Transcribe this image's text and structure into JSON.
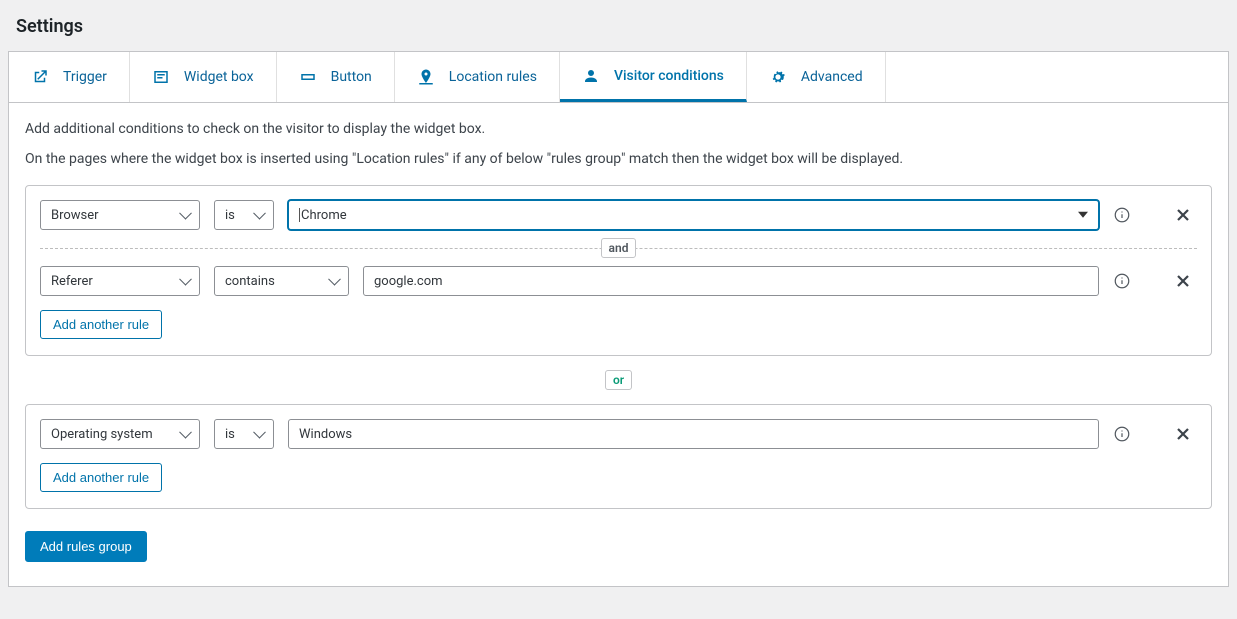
{
  "page_title": "Settings",
  "tabs": {
    "trigger": "Trigger",
    "widget_box": "Widget box",
    "button": "Button",
    "location_rules": "Location rules",
    "visitor_conditions": "Visitor conditions",
    "advanced": "Advanced"
  },
  "intro1": "Add additional conditions to check on the visitor to display the widget box.",
  "intro2": "On the pages where the widget box is inserted using \"Location rules\" if any of below \"rules group\" match then the widget box will be displayed.",
  "connectors": {
    "and": "and",
    "or": "or"
  },
  "buttons": {
    "add_rule": "Add another rule",
    "add_group": "Add rules group"
  },
  "groups": [
    {
      "rules": [
        {
          "attr": "Browser",
          "op": "is",
          "val": "Chrome",
          "focused": true,
          "op_wide": false
        },
        {
          "attr": "Referer",
          "op": "contains",
          "val": "google.com",
          "focused": false,
          "op_wide": true
        }
      ]
    },
    {
      "rules": [
        {
          "attr": "Operating system",
          "op": "is",
          "val": "Windows",
          "focused": false,
          "op_wide": false
        }
      ]
    }
  ]
}
